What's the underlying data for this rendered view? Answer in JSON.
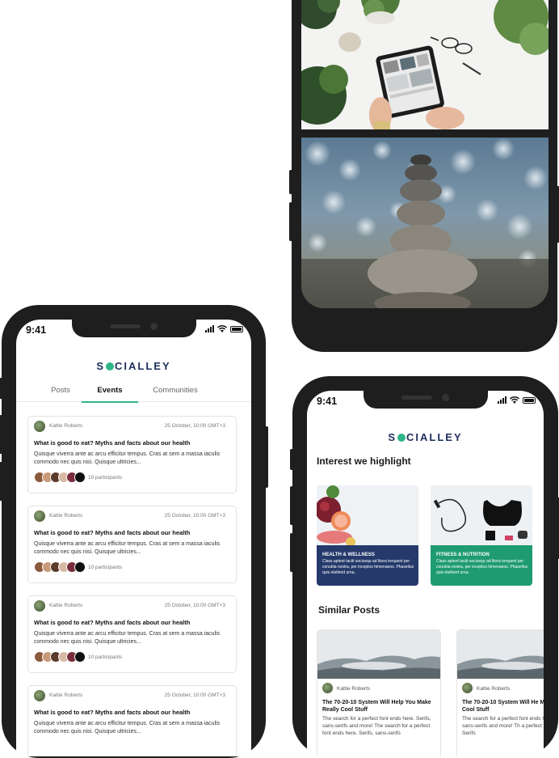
{
  "brand": {
    "logo_left": "S",
    "logo_right": "CIALLEY",
    "accent": "#2fb58a",
    "navy": "#1e2f5c"
  },
  "status": {
    "time": "9:41"
  },
  "events_screen": {
    "tabs": [
      {
        "label": "Posts"
      },
      {
        "label": "Events"
      },
      {
        "label": "Communities"
      }
    ],
    "cards": [
      {
        "author": "Kattie Roberts",
        "date": "25 October, 10:00 GMT+3",
        "title": "What is good to eat? Myths and facts about our health",
        "body": "Quisque viverra ante ac arcu efficitur tempus. Cras at sem a massa iaculis commodo nec quis nisi. Quisque ultricies...",
        "participants": "10 participants"
      },
      {
        "author": "Kattie Roberts",
        "date": "25 October, 10:00 GMT+3",
        "title": "What is good to eat? Myths and facts about our health",
        "body": "Quisque viverra ante ac arcu efficitur tempus. Cras at sem a massa iaculis commodo nec quis nisi. Quisque ultricies...",
        "participants": "10 participants"
      },
      {
        "author": "Kattie Roberts",
        "date": "25 October, 10:00 GMT+3",
        "title": "What is good to eat? Myths and facts about our health",
        "body": "Quisque viverra ante ac arcu efficitur tempus. Cras at sem a massa iaculis commodo nec quis nisi. Quisque ultricies...",
        "participants": "10 participants"
      },
      {
        "author": "Kattie Roberts",
        "date": "25 October, 10:00 GMT+3",
        "title": "What is good to eat? Myths and facts about our health",
        "body": "Quisque viverra ante ac arcu efficitur tempus. Cras at sem a massa iaculis commodo nec quis nisi. Quisque ultricies..."
      }
    ]
  },
  "home_screen": {
    "interest_title": "Interest we highlight",
    "interests": [
      {
        "title": "HEALTH & WELLNESS",
        "desc": "Class aptent taciti sociosqu ad litora torquent per conubia nostra, per inceptos himenaeos. Phasellus quis eleifend urna.",
        "color": "#253a6b"
      },
      {
        "title": "FITNESS & NUTRITION",
        "desc": "Class aptent taciti sociosqu ad litora torquent per conubia nostra, per inceptos himenaeos. Phasellus quis eleifend urna.",
        "color": "#1f9b72"
      }
    ],
    "similar_title": "Similar Posts",
    "posts": [
      {
        "author": "Kattie Roberts",
        "title": "The 70-20-10 System Will Help You Make Really Cool Stuff",
        "body": "The search for a perfect font ends here. Serifs, sans-serifs and more! The search for a perfect font ends here. Serifs, sans-serifs"
      },
      {
        "author": "Kattie Roberts",
        "title": "The 70-20-10 System Will He Make Really Cool Stuff",
        "body": "The search for a perfect font ends here. Serifs, sans-serifs and more! Th a perfect font ends here. Serifs"
      }
    ]
  }
}
